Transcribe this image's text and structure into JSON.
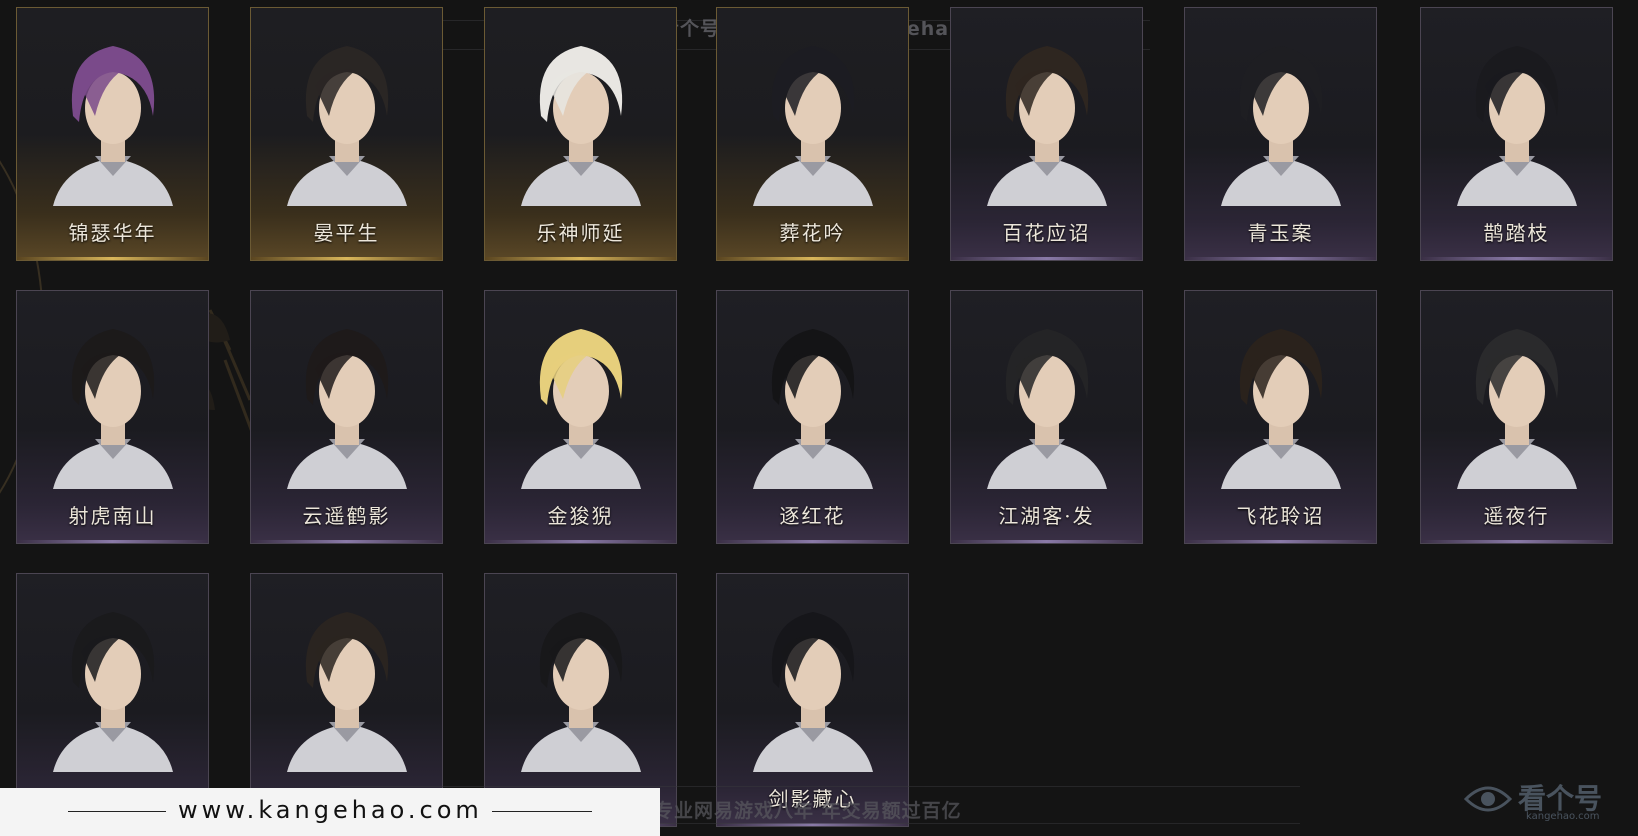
{
  "hairstyles": [
    {
      "name": "锦瑟华年",
      "tier": "gold",
      "hair": "#7a4a8a"
    },
    {
      "name": "晏平生",
      "tier": "gold",
      "hair": "#2a2624"
    },
    {
      "name": "乐神师延",
      "tier": "gold",
      "hair": "#e8e6e2"
    },
    {
      "name": "葬花吟",
      "tier": "gold",
      "hair": "#1c1c22"
    },
    {
      "name": "百花应诏",
      "tier": "purple",
      "hair": "#2e2620"
    },
    {
      "name": "青玉案",
      "tier": "purple",
      "hair": "#1e1e22"
    },
    {
      "name": "鹊踏枝",
      "tier": "purple",
      "hair": "#1a1a1e"
    },
    {
      "name": "射虎南山",
      "tier": "purple",
      "hair": "#1c1a1a"
    },
    {
      "name": "云遥鹤影",
      "tier": "purple",
      "hair": "#1e1a1a"
    },
    {
      "name": "金狻猊",
      "tier": "purple",
      "hair": "#e6cf7c"
    },
    {
      "name": "逐红花",
      "tier": "purple",
      "hair": "#141416"
    },
    {
      "name": "江湖客·发",
      "tier": "purple",
      "hair": "#242426"
    },
    {
      "name": "飞花聆诏",
      "tier": "purple",
      "hair": "#2a221c"
    },
    {
      "name": "遥夜行",
      "tier": "purple",
      "hair": "#2a2a2c"
    },
    {
      "name": "",
      "tier": "purple",
      "hair": "#1a1a1c"
    },
    {
      "name": "",
      "tier": "purple",
      "hair": "#2a2420"
    },
    {
      "name": "",
      "tier": "purple",
      "hair": "#18181a"
    },
    {
      "name": "剑影藏心",
      "tier": "purple",
      "hair": "#16161a"
    }
  ],
  "watermark_top": "网易游戏就选看个号    网址：www.kangehao.com",
  "footer": {
    "url": "www.kangehao.com",
    "slogan": "看个号专业网易游戏八年    年交易额过百亿"
  },
  "brand": {
    "name": "看个号",
    "sub": "kangehao.com"
  }
}
